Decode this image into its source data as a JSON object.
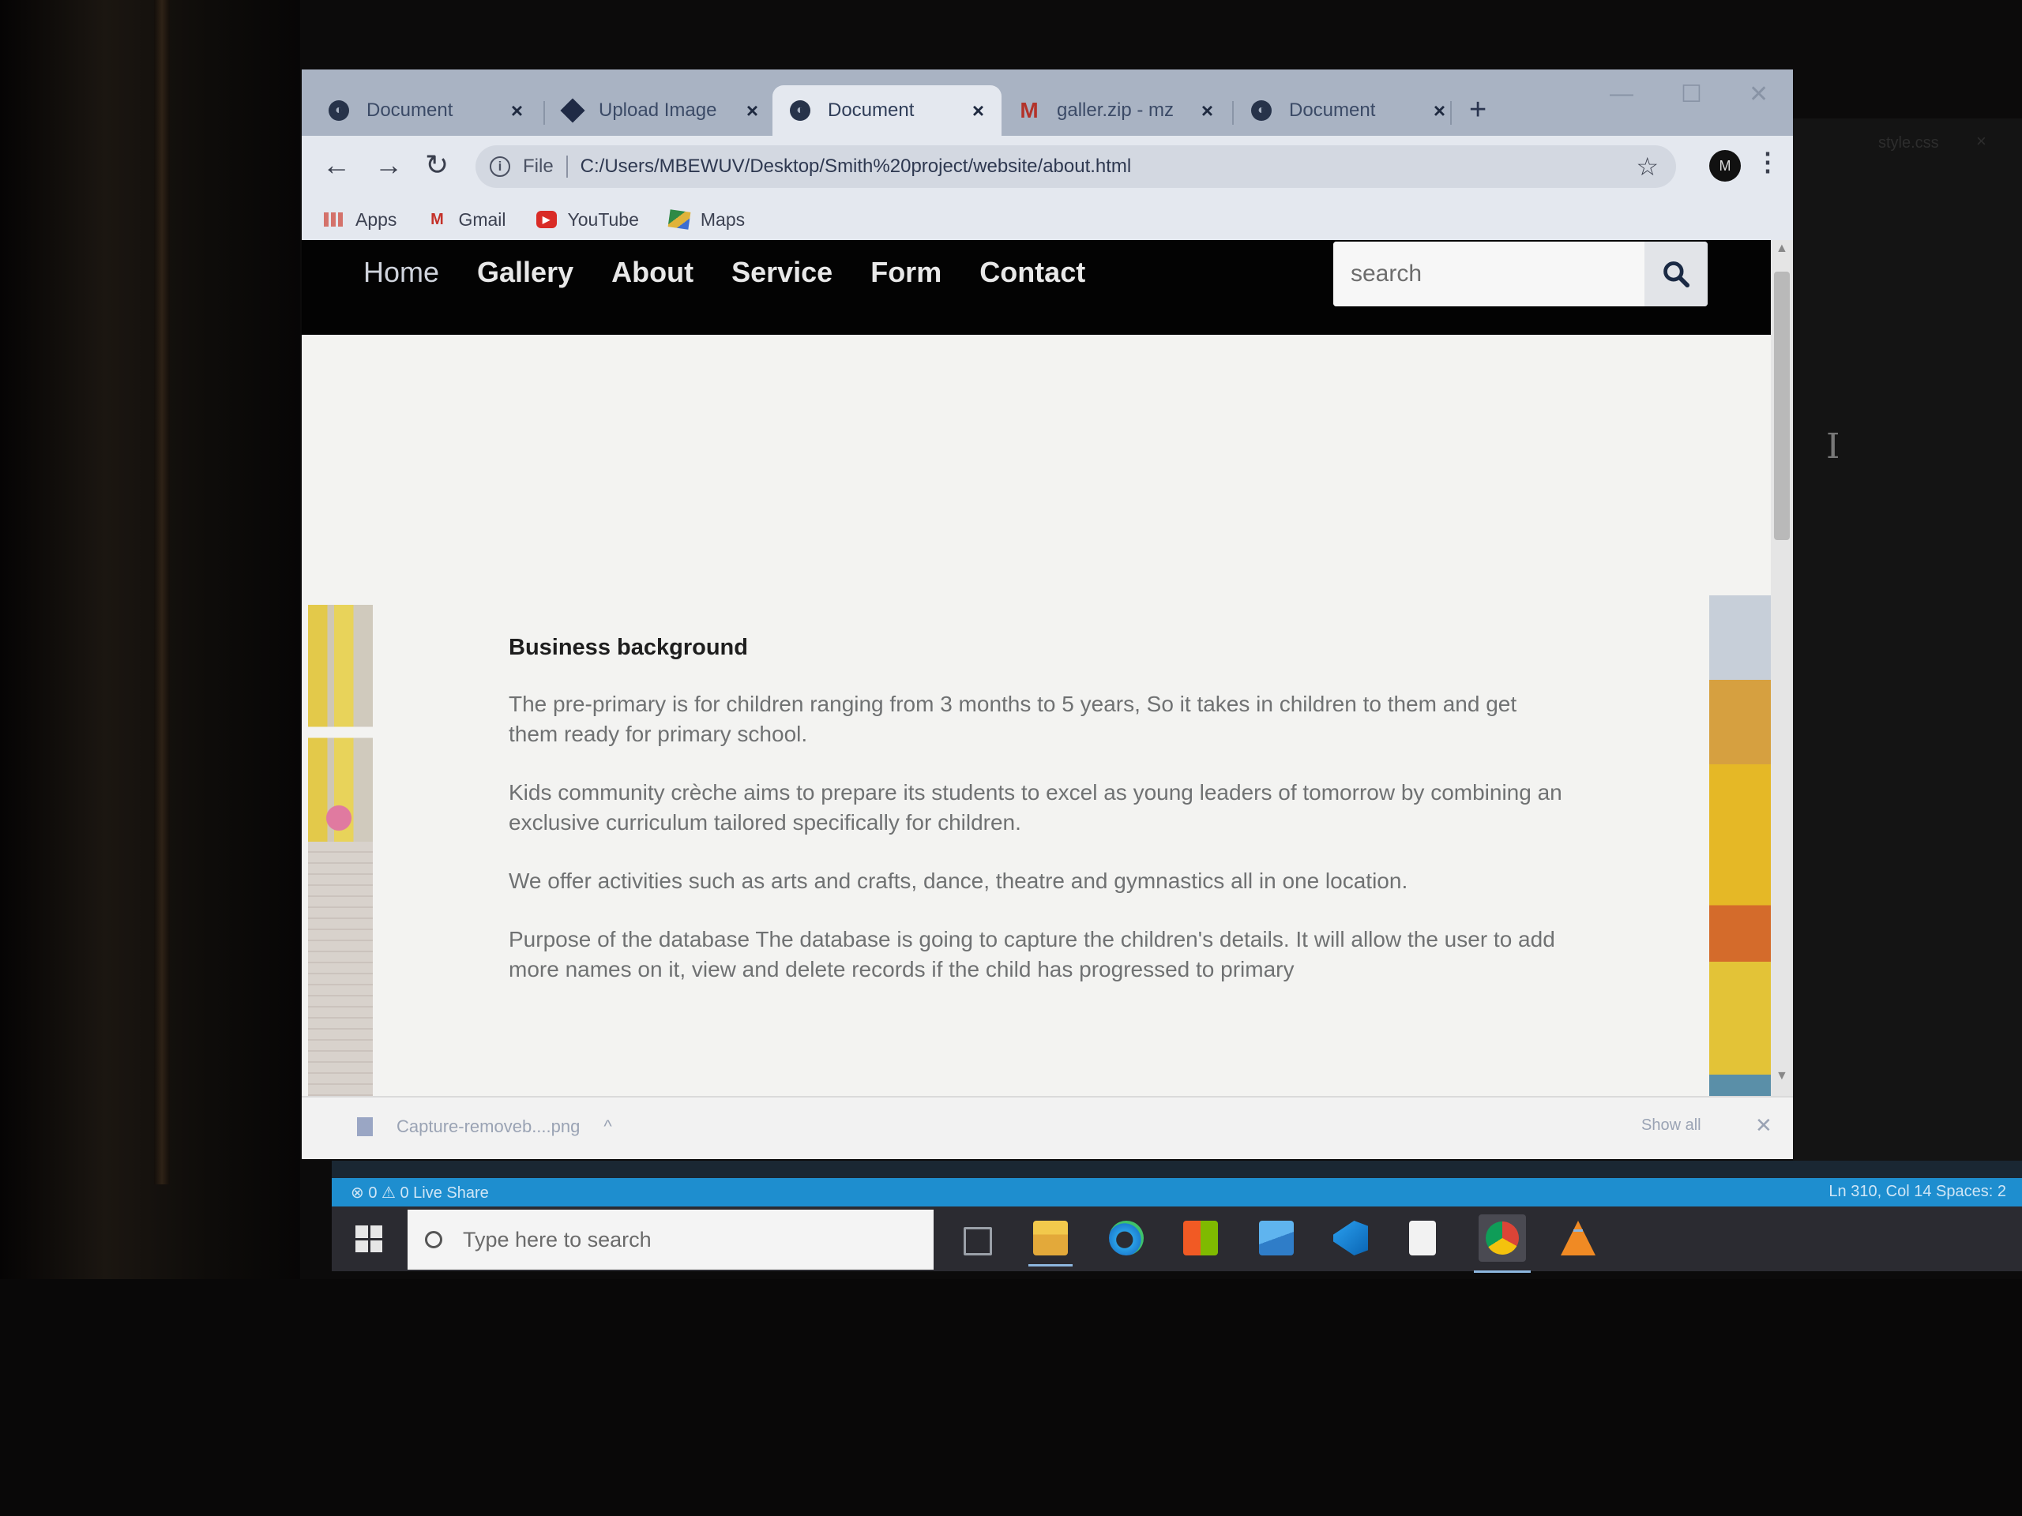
{
  "browser": {
    "tabs": [
      {
        "label": "Document",
        "favicon": "globe-icon",
        "active": false
      },
      {
        "label": "Upload Image",
        "favicon": "diamond-icon",
        "active": false
      },
      {
        "label": "Document",
        "favicon": "globe-icon",
        "active": true
      },
      {
        "label": "galler.zip - mz",
        "favicon": "gmail-icon",
        "active": false
      },
      {
        "label": "Document",
        "favicon": "globe-icon",
        "active": false
      }
    ],
    "address": {
      "scheme": "File",
      "url": "C:/Users/MBEWUV/Desktop/Smith%20project/website/about.html"
    },
    "profile_initial": "M",
    "bookmarks": [
      {
        "label": "Apps",
        "icon": "apps-grid-icon"
      },
      {
        "label": "Gmail",
        "icon": "gmail-icon"
      },
      {
        "label": "YouTube",
        "icon": "youtube-icon"
      },
      {
        "label": "Maps",
        "icon": "maps-icon"
      }
    ]
  },
  "site": {
    "nav": [
      "Home",
      "Gallery",
      "About",
      "Service",
      "Form",
      "Contact"
    ],
    "search_placeholder": "search",
    "heading": "Business background",
    "paragraphs": [
      "The pre-primary is for children ranging from 3 months to 5 years, So it takes in children to them and get them ready for primary school.",
      "Kids community crèche aims to prepare its students to excel as young leaders of tomorrow by combining an exclusive curriculum tailored specifically for children.",
      "We offer activities such as arts and crafts, dance, theatre and gymnastics all in one location.",
      "Purpose of the database The database is going to capture the children's details. It will allow the user to add more names on it, view and delete records if the child has progressed to primary"
    ]
  },
  "downloads": {
    "file": "Capture-removeb....png",
    "show_all": "Show all"
  },
  "editor": {
    "tab": "style.css",
    "status_left": "⊗ 0 ⚠ 0   Live Share",
    "status_right": "Ln 310, Col 14   Spaces: 2"
  },
  "taskbar": {
    "search_placeholder": "Type here to search"
  },
  "colors": {
    "nav_bg": "#030303",
    "tabstrip": "#a9b3c3",
    "vscode_blue": "#1e8ecf",
    "taskbar": "#2b2b31"
  }
}
